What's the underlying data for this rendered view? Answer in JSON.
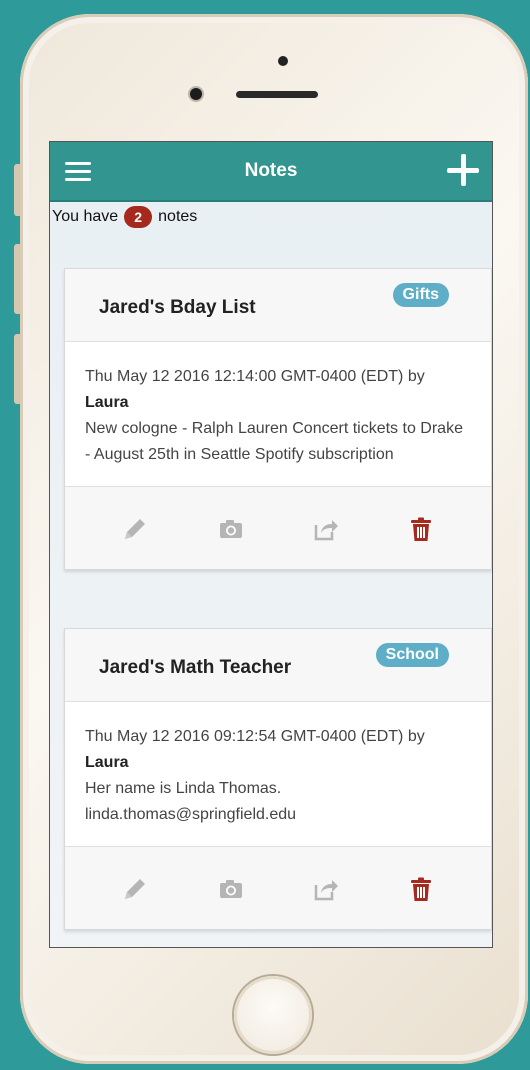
{
  "app": {
    "title": "Notes"
  },
  "summary": {
    "prefix": "You have",
    "count": "2",
    "suffix": "notes"
  },
  "notes": [
    {
      "title": "Jared's Bday List",
      "tag": "Gifts",
      "date": "Thu May 12 2016 12:14:00 GMT-0400 (EDT) by",
      "author": "Laura",
      "body": "New cologne - Ralph Lauren Concert tickets to Drake - August 25th in Seattle Spotify subscription"
    },
    {
      "title": "Jared's Math Teacher",
      "tag": "School",
      "date": "Thu May 12 2016 09:12:54 GMT-0400 (EDT) by",
      "author": "Laura",
      "body": "Her name is Linda Thomas. linda.thomas@springfield.edu"
    }
  ],
  "icons": {
    "menu": "hamburger-menu-icon",
    "add": "plus-icon",
    "edit": "pencil-icon",
    "photo": "camera-icon",
    "share": "share-icon",
    "delete": "trash-icon"
  },
  "colors": {
    "navbar": "#33958f",
    "badge": "#a52a1d",
    "tag": "#5faec8",
    "delete": "#a52a1d",
    "muted_icon": "#b5b5b5"
  }
}
